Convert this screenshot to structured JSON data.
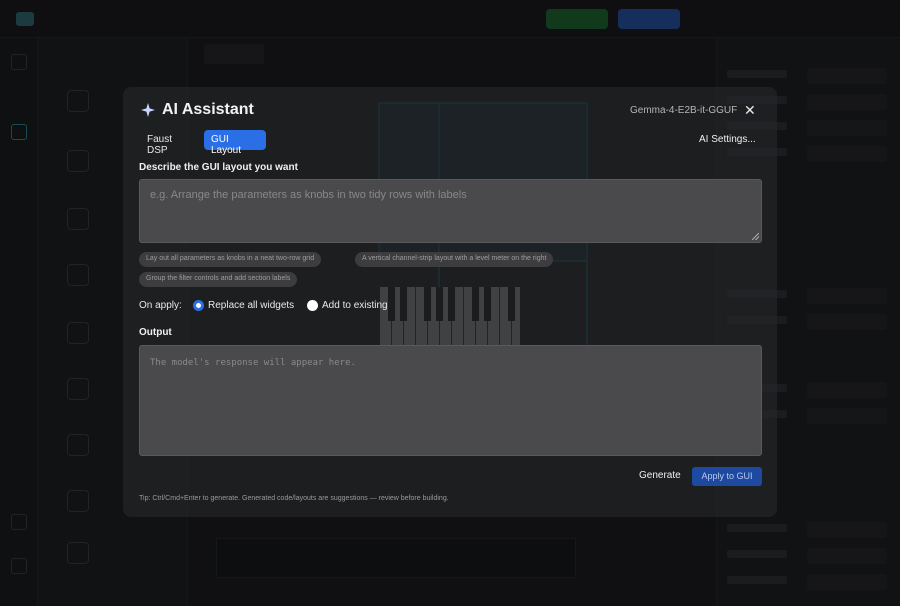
{
  "dialog": {
    "title": "AI Assistant",
    "model": "Gemma-4-E2B-it-GGUF",
    "close_glyph": "✕",
    "tabs": [
      {
        "label": "Faust DSP",
        "active": false
      },
      {
        "label": "GUI Layout",
        "active": true
      }
    ],
    "ai_settings_label": "AI Settings...",
    "describe_label": "Describe the GUI layout you want",
    "prompt_placeholder": "e.g. Arrange the parameters as knobs in two tidy rows with labels",
    "suggestions": [
      "Lay out all parameters as knobs in a neat two-row grid",
      "A vertical channel-strip layout with a level meter on the right",
      "Group the filter controls and add section labels"
    ],
    "on_apply_label": "On apply:",
    "apply_options": [
      {
        "label": "Replace all widgets",
        "checked": true
      },
      {
        "label": "Add to existing",
        "checked": false
      }
    ],
    "output_label": "Output",
    "output_placeholder": "The model's response will appear here.",
    "generate_label": "Generate",
    "apply_label": "Apply to GUI",
    "tip": "Tip: Ctrl/Cmd+Enter to generate. Generated code/layouts are suggestions — review before building."
  },
  "colors": {
    "accent": "#2b6fe6",
    "overlay": "rgba(10,10,12,0.62)",
    "field_bg": "#4a4a4c"
  },
  "icons": {
    "title_icon": "sparkle-icon",
    "close_icon": "close-icon"
  }
}
